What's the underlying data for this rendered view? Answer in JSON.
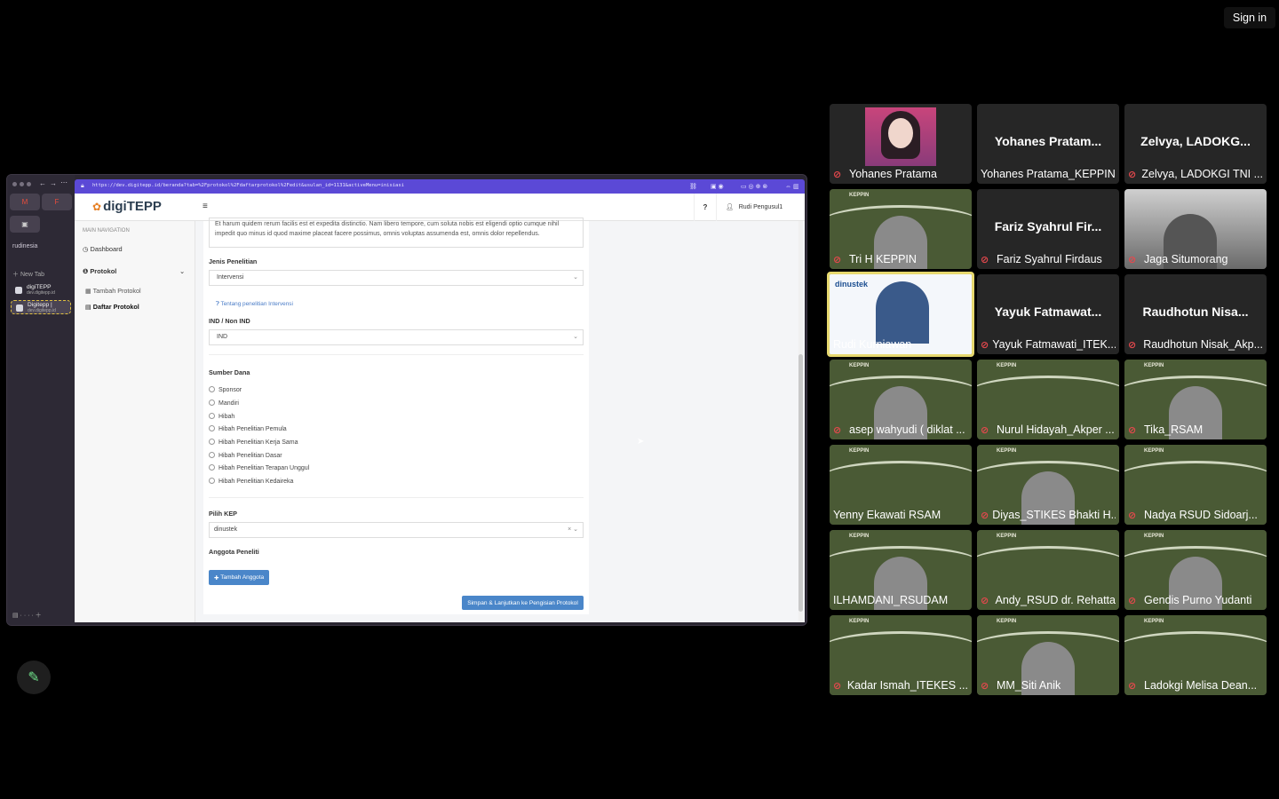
{
  "meeting": {
    "sign_in_label": "Sign in"
  },
  "browser": {
    "workspace_label": "rudinesia",
    "new_tab_label": "New Tab",
    "tabs": [
      {
        "title": "digiTEPP",
        "subtitle": "dev.digitepp.id"
      },
      {
        "title": "Digitepp |",
        "subtitle": "dev.digitepp.id"
      }
    ],
    "url": "https://dev.digitepp.id/beranda?tab=%2Fprotokol%2Fdaftarprotokol%2Fedit&usulan_id=1131&activeMenu=inisiasi"
  },
  "app": {
    "logo_text": "digiTEPP",
    "help_label": "?",
    "user_name": "Rudi Pengusul1",
    "nav": {
      "header": "MAIN NAVIGATION",
      "dashboard": "Dashboard",
      "protokol": "Protokol",
      "tambah": "Tambah Protokol",
      "daftar": "Daftar Protokol"
    },
    "form": {
      "description_text": "Et harum quidem rerum facilis est et expedita distinctio. Nam libero tempore, cum soluta nobis est eligendi optio cumque nihil impedit quo minus id quod maxime placeat facere possimus, omnis voluptas assumenda est, omnis dolor repellendus.",
      "jenis_label": "Jenis Penelitian",
      "jenis_value": "Intervensi",
      "info_link": "Tentang penelitian Intervensi",
      "ind_label": "IND / Non IND",
      "ind_value": "IND",
      "sumber_label": "Sumber Dana",
      "sumber_options": [
        "Sponsor",
        "Mandiri",
        "Hibah",
        "Hibah Penelitian Pemula",
        "Hibah Penelitian Kerja Sama",
        "Hibah Penelitian Dasar",
        "Hibah Penelitian Terapan Unggul",
        "Hibah Penelitian Kedaireka"
      ],
      "kep_label": "Pilih KEP",
      "kep_value": "dinustek",
      "anggota_label": "Anggota Peneliti",
      "add_member_label": "Tambah Anggota",
      "save_label": "Simpan & Lanjutkan ke Pengisian Protokol"
    }
  },
  "participants": [
    {
      "display": "",
      "label": "Yohanes Pratama",
      "muted": true,
      "kind": "photo"
    },
    {
      "display": "Yohanes Pratam...",
      "label": "Yohanes Pratama_KEPPIN",
      "muted": false,
      "kind": "name"
    },
    {
      "display": "Zelvya, LADOKG...",
      "label": "Zelvya, LADOKGI TNI ...",
      "muted": true,
      "kind": "name"
    },
    {
      "display": "",
      "label": "Tri H KEPPIN",
      "muted": true,
      "kind": "green"
    },
    {
      "display": "Fariz Syahrul Fir...",
      "label": "Fariz Syahrul Firdaus",
      "muted": true,
      "kind": "name"
    },
    {
      "display": "",
      "label": "Jaga Situmorang",
      "muted": true,
      "kind": "office"
    },
    {
      "display": "",
      "label": "Rudi Kurniawan",
      "muted": false,
      "kind": "dinustek"
    },
    {
      "display": "Yayuk Fatmawat...",
      "label": "Yayuk Fatmawati_ITEK...",
      "muted": true,
      "kind": "name"
    },
    {
      "display": "Raudhotun Nisa...",
      "label": "Raudhotun Nisak_Akp...",
      "muted": true,
      "kind": "name"
    },
    {
      "display": "",
      "label": "asep wahyudi ( diklat ...",
      "muted": true,
      "kind": "green"
    },
    {
      "display": "",
      "label": "Nurul Hidayah_Akper ...",
      "muted": true,
      "kind": "green"
    },
    {
      "display": "",
      "label": "Tika_RSAM",
      "muted": true,
      "kind": "green"
    },
    {
      "display": "",
      "label": "Yenny Ekawati RSAM",
      "muted": false,
      "kind": "green"
    },
    {
      "display": "",
      "label": "Diyas_STIKES Bhakti H...",
      "muted": true,
      "kind": "green"
    },
    {
      "display": "",
      "label": "Nadya RSUD Sidoarj...",
      "muted": true,
      "kind": "green"
    },
    {
      "display": "",
      "label": "ILHAMDANI_RSUDAM",
      "muted": false,
      "kind": "green"
    },
    {
      "display": "",
      "label": "Andy_RSUD dr. Rehatta",
      "muted": true,
      "kind": "green"
    },
    {
      "display": "",
      "label": "Gendis Purno Yudanti",
      "muted": true,
      "kind": "green"
    },
    {
      "display": "",
      "label": "Kadar Ismah_ITEKES ...",
      "muted": true,
      "kind": "green"
    },
    {
      "display": "",
      "label": "MM_Siti Anik",
      "muted": true,
      "kind": "green"
    },
    {
      "display": "",
      "label": "Ladokgi Melisa Dean...",
      "muted": true,
      "kind": "green"
    }
  ],
  "colors": {
    "accent": "#5b49d6",
    "primary_button": "#4a86c9",
    "muted_icon": "#e5484d",
    "speaker_highlight": "#e6d86f"
  }
}
